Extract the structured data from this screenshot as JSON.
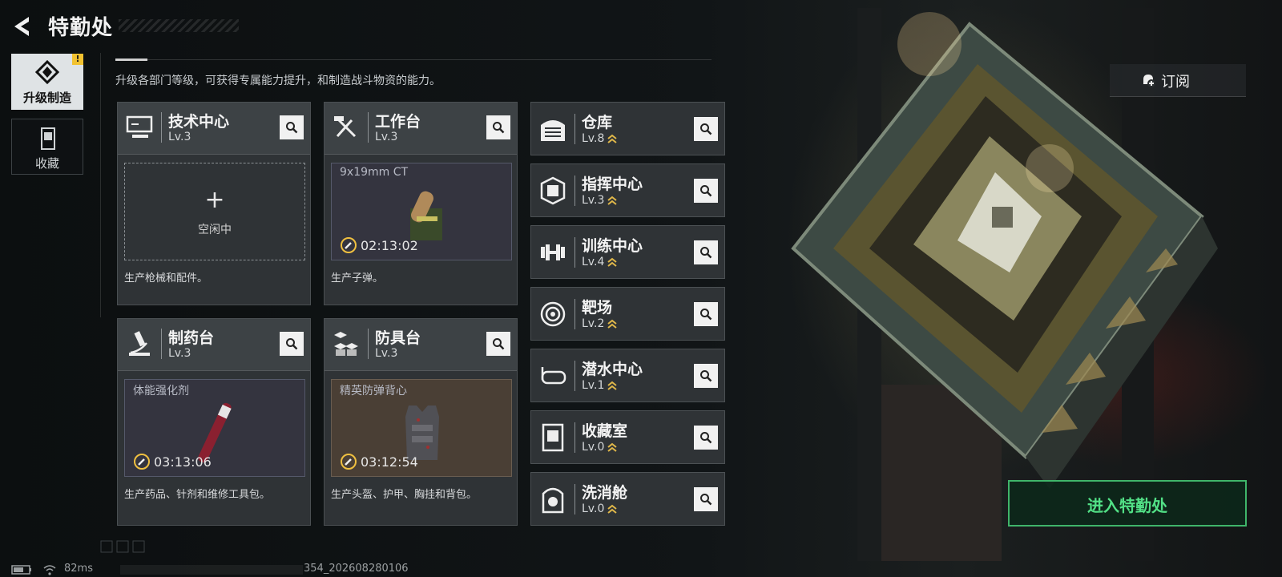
{
  "header": {
    "title": "特勤处"
  },
  "sidebar": {
    "tabs": [
      {
        "label": "升级制造",
        "active": true,
        "alert": "!"
      },
      {
        "label": "收藏",
        "active": false
      }
    ]
  },
  "description": "升级各部门等级，可获得专属能力提升，和制造战斗物资的能力。",
  "workshops": [
    {
      "name": "技术中心",
      "level": "Lv.3",
      "slot": {
        "state": "idle",
        "plus": "+",
        "label": "空闲中"
      },
      "desc": "生产枪械和配件。"
    },
    {
      "name": "工作台",
      "level": "Lv.3",
      "slot": {
        "state": "producing",
        "item": "9x19mm CT",
        "timer": "02:13:02"
      },
      "desc": "生产子弹。"
    },
    {
      "name": "制药台",
      "level": "Lv.3",
      "slot": {
        "state": "producing",
        "item": "体能强化剂",
        "timer": "03:13:06"
      },
      "desc": "生产药品、针剂和维修工具包。"
    },
    {
      "name": "防具台",
      "level": "Lv.3",
      "slot": {
        "state": "producing",
        "item": "精英防弹背心",
        "timer": "03:12:54"
      },
      "desc": "生产头盔、护甲、胸挂和背包。"
    }
  ],
  "departments": [
    {
      "name": "仓库",
      "level": "Lv.8",
      "icon": "warehouse-icon"
    },
    {
      "name": "指挥中心",
      "level": "Lv.3",
      "icon": "chip-icon"
    },
    {
      "name": "训练中心",
      "level": "Lv.4",
      "icon": "dumbbell-icon"
    },
    {
      "name": "靶场",
      "level": "Lv.2",
      "icon": "target-icon"
    },
    {
      "name": "潜水中心",
      "level": "Lv.1",
      "icon": "diving-mask-icon"
    },
    {
      "name": "收藏室",
      "level": "Lv.0",
      "icon": "collection-room-icon"
    },
    {
      "name": "洗消舱",
      "level": "Lv.0",
      "icon": "decontamination-icon"
    }
  ],
  "subscribe_label": "订阅",
  "enter_label": "进入特勤处",
  "status": {
    "ping": "82ms",
    "version": "354_202608280106"
  },
  "colors": {
    "accent_green": "#3fb56a",
    "alert_yellow": "#f2c230",
    "timer_yellow": "#f0c040"
  }
}
